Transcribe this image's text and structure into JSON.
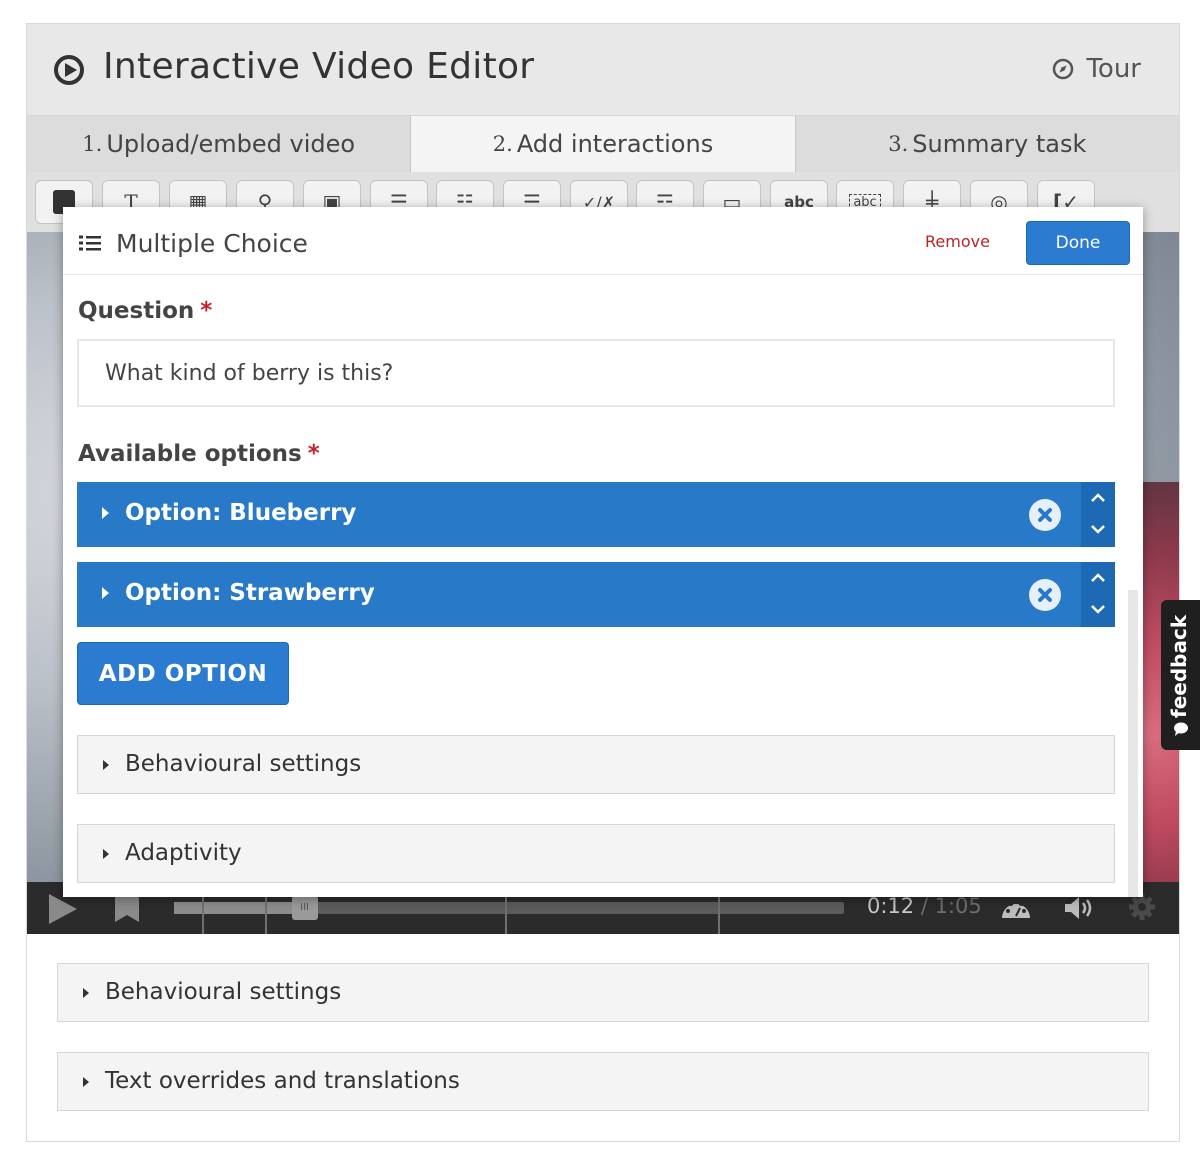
{
  "header": {
    "title": "Interactive Video Editor",
    "tour_label": "Tour"
  },
  "tabs": [
    {
      "num": "1.",
      "label": "Upload/embed video"
    },
    {
      "num": "2.",
      "label": "Add interactions"
    },
    {
      "num": "3.",
      "label": "Summary task"
    }
  ],
  "toolbar": {
    "tools": [
      "label-icon",
      "text-icon",
      "table-icon",
      "link-icon",
      "image-icon",
      "statements-icon",
      "single-choice-icon",
      "multiple-choice-icon",
      "true-false-icon",
      "drag-text-icon",
      "mark-words-icon",
      "fill-blanks-icon",
      "drag-drop-icon",
      "crossroads-icon",
      "navigation-hotspot-icon",
      "questionnaire-icon"
    ]
  },
  "player": {
    "current_time": "0:12",
    "total_time": "/ 1:05",
    "progress": 0.18
  },
  "dialog": {
    "title": "Multiple Choice",
    "remove_label": "Remove",
    "done_label": "Done",
    "question_label": "Question",
    "required_mark": "*",
    "question_value": "What kind of berry is this?",
    "options_label": "Available options",
    "options": [
      {
        "label": "Option: Blueberry"
      },
      {
        "label": "Option: Strawberry"
      }
    ],
    "add_option_label": "ADD OPTION",
    "behavioural_label": "Behavioural settings",
    "adaptivity_label": "Adaptivity"
  },
  "sections": {
    "behavioural_label": "Behavioural settings",
    "text_overrides_label": "Text overrides and translations"
  },
  "feedback_label": "feedback",
  "colors": {
    "primary": "#2879c8",
    "remove": "#b8242a",
    "required": "#c8202a"
  }
}
